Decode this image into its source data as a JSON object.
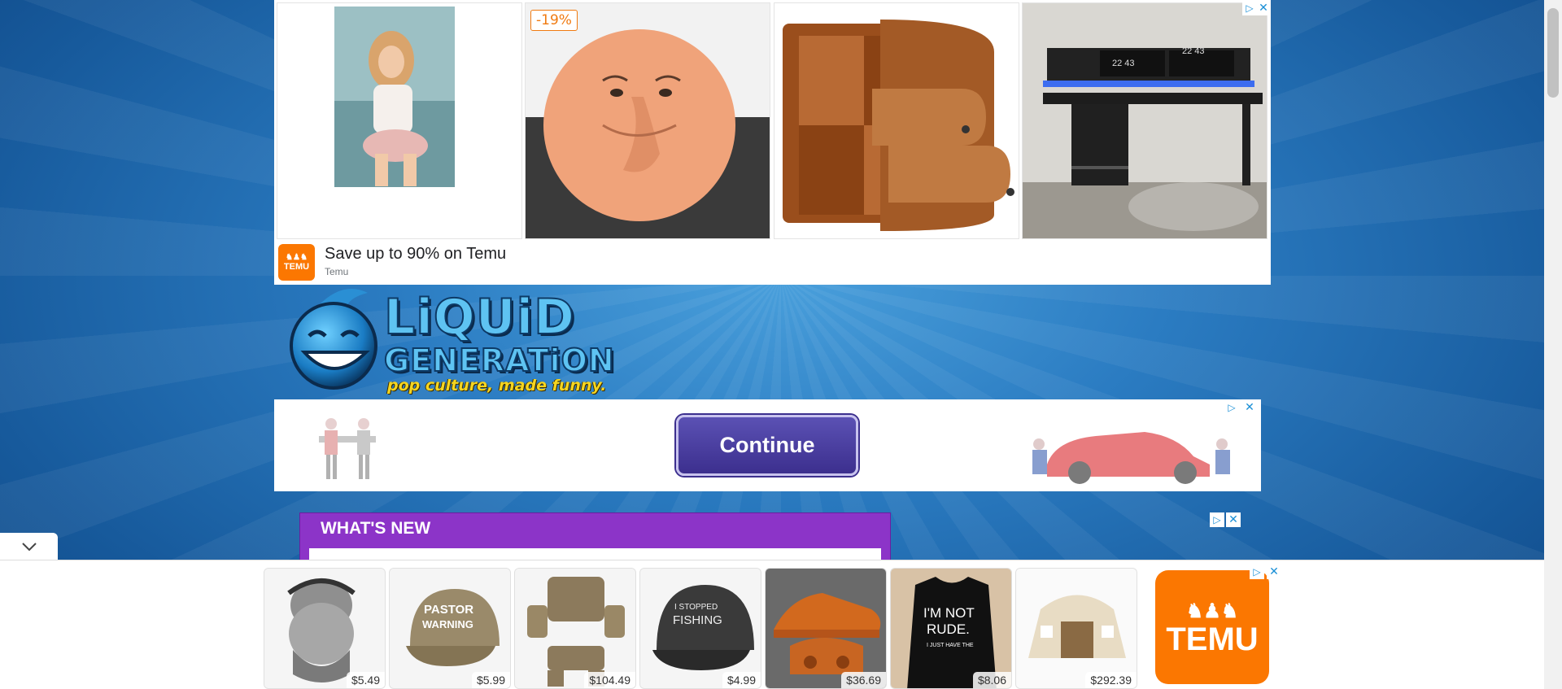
{
  "top_ad": {
    "discount_badge": "-19%",
    "headline": "Save up to 90% on Temu",
    "advertiser": "Temu",
    "logo_text": "TEMU",
    "tiles": [
      {
        "name": "ad-image-woman-chair"
      },
      {
        "name": "ad-image-squishy-face"
      },
      {
        "name": "ad-image-wooden-cabinet"
      },
      {
        "name": "ad-image-gaming-desk"
      }
    ]
  },
  "site_logo": {
    "word1": "LiQUiD",
    "word2": "GENERATiON",
    "tagline": "pop culture, made funny."
  },
  "mid_ad": {
    "continue_label": "Continue"
  },
  "whats_new": {
    "title": "WHAT'S NEW"
  },
  "bottom_ad": {
    "products": [
      {
        "name": "cat-mask-scarf",
        "price": "$5.49"
      },
      {
        "name": "pastor-warning-cap",
        "price": "$5.99",
        "print": "PASTOR WARNING"
      },
      {
        "name": "tactical-armor-vest",
        "price": "$104.49"
      },
      {
        "name": "fishing-cap",
        "price": "$4.99",
        "print": "I STOPPED FISHING"
      },
      {
        "name": "orange-sneakers",
        "price": "$36.69"
      },
      {
        "name": "im-not-rude-tshirt",
        "price": "$8.06",
        "print": "I'M NOT RUDE."
      },
      {
        "name": "camping-tent",
        "price": "$292.39"
      }
    ],
    "logo_text": "TEMU"
  },
  "colors": {
    "temu_orange": "#fb7701",
    "whats_new_purple": "#8c34c8",
    "continue_purple": "#3c2f8e",
    "adchoices_blue": "#1a8fd6"
  }
}
